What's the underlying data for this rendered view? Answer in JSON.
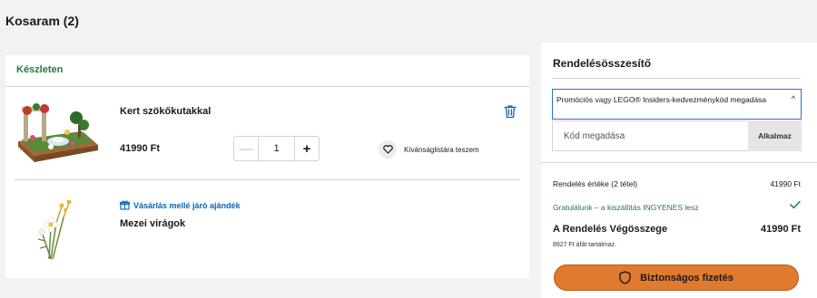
{
  "page": {
    "title": "Kosaram (2)"
  },
  "cart": {
    "stock_label": "Készleten",
    "items": [
      {
        "name": "Kert szökőkutakkal",
        "price": "41990 Ft",
        "quantity": "1",
        "wishlist_label": "Kívánságlistára teszem"
      },
      {
        "gift_label": "Vásárlás mellé járó ajándék",
        "name": "Mezei virágok"
      }
    ]
  },
  "summary": {
    "title": "Rendelésösszesítő",
    "promo": {
      "toggle_label": "Promóciós vagy LEGO® Insiders-kedvezménykód megadása",
      "caret": "^",
      "placeholder": "Kód megadása",
      "apply_label": "Alkalmaz"
    },
    "order_value_label": "Rendelés értéke (2 tétel)",
    "order_value": "41990 Ft",
    "shipping_text": "Gratulálunk – a kiszállítás INGYENES lesz",
    "total_label": "A Rendelés Végösszege",
    "total_value": "41990 Ft",
    "vat_note": "8927 Ft áfát tartalmaz.",
    "pay_label": "Biztonságos fizetés"
  },
  "colors": {
    "accent_green": "#237a3b",
    "link_blue": "#0a63b5",
    "pay_orange": "#e07a2f",
    "focus_blue": "#2a6fdb"
  },
  "icons": [
    "trash-icon",
    "heart-icon",
    "gift-icon",
    "check-icon",
    "shield-icon",
    "chevron-up-icon"
  ]
}
